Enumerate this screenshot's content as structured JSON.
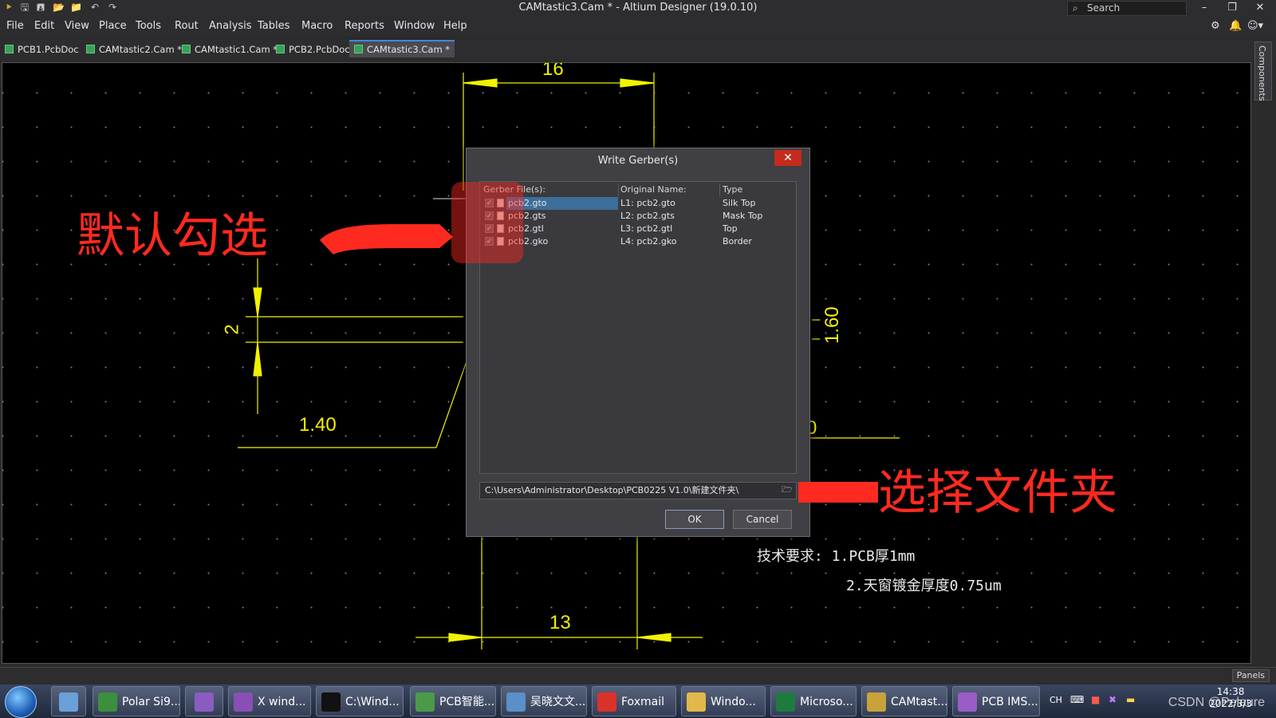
{
  "window": {
    "title": "CAMtastic3.Cam * - Altium Designer (19.0.10)",
    "search_label": "Search"
  },
  "menu": [
    "File",
    "Edit",
    "View",
    "Place",
    "Tools",
    "Rout",
    "Analysis",
    "Tables",
    "Macro",
    "Reports",
    "Window",
    "Help"
  ],
  "tabs": [
    {
      "label": "PCB1.PcbDoc"
    },
    {
      "label": "CAMtastic2.Cam *"
    },
    {
      "label": "CAMtastic1.Cam *"
    },
    {
      "label": "PCB2.PcbDoc"
    },
    {
      "label": "CAMtastic3.Cam *",
      "active": true
    }
  ],
  "side_panel_label": "Components",
  "canvas": {
    "dims": {
      "top": "16",
      "left_vertical": "2",
      "left_bottom": "1.40",
      "right_vertical": "1.60",
      "right_partial": "0",
      "bottom": "13"
    },
    "annotation_left": "默认勾选",
    "annotation_right": "选择文件夹",
    "notes": {
      "line1": "技术要求: 1.PCB厚1mm",
      "line2": "2.天窗镀金厚度0.75um"
    }
  },
  "dialog": {
    "title": "Write Gerber(s)",
    "columns": {
      "file": "Gerber File(s):",
      "original": "Original Name:",
      "type": "Type"
    },
    "rows": [
      {
        "file": "pcb2.gto",
        "original": "L1: pcb2.gto",
        "type": "Silk Top",
        "checked": true,
        "selected": true
      },
      {
        "file": "pcb2.gts",
        "original": "L2: pcb2.gts",
        "type": "Mask Top",
        "checked": true
      },
      {
        "file": "pcb2.gtl",
        "original": "L3: pcb2.gtl",
        "type": "Top",
        "checked": true
      },
      {
        "file": "pcb2.gko",
        "original": "L4: pcb2.gko",
        "type": "Border",
        "checked": true
      }
    ],
    "path": "C:\\Users\\Administrator\\Desktop\\PCB0225 V1.0\\新建文件夹\\",
    "ok": "OK",
    "cancel": "Cancel"
  },
  "status": {
    "panels": "Panels"
  },
  "taskbar": {
    "items": [
      {
        "label": "Polar Si9...",
        "color": "#3c8f3c"
      },
      {
        "label": "",
        "color": "#8a5cc0"
      },
      {
        "label": "X wind...",
        "color": "#8a4fb5"
      },
      {
        "label": "C:\\Wind...",
        "color": "#111111"
      },
      {
        "label": "PCB智能...",
        "color": "#4a9a4a"
      },
      {
        "label": "吴晓文文...",
        "color": "#5a8fc8"
      },
      {
        "label": "Foxmail",
        "color": "#d9322a"
      },
      {
        "label": "Windo...",
        "color": "#e3b84a"
      },
      {
        "label": "Microso...",
        "color": "#1e7b3e"
      },
      {
        "label": "CAMtast...",
        "color": "#c9a23a"
      },
      {
        "label": "PCB IMS...",
        "color": "#9a5cc6"
      }
    ],
    "tray_lang": "CH",
    "time": "14:38",
    "date": "2022/3/3",
    "watermark": "CSDN @Pelaure"
  }
}
